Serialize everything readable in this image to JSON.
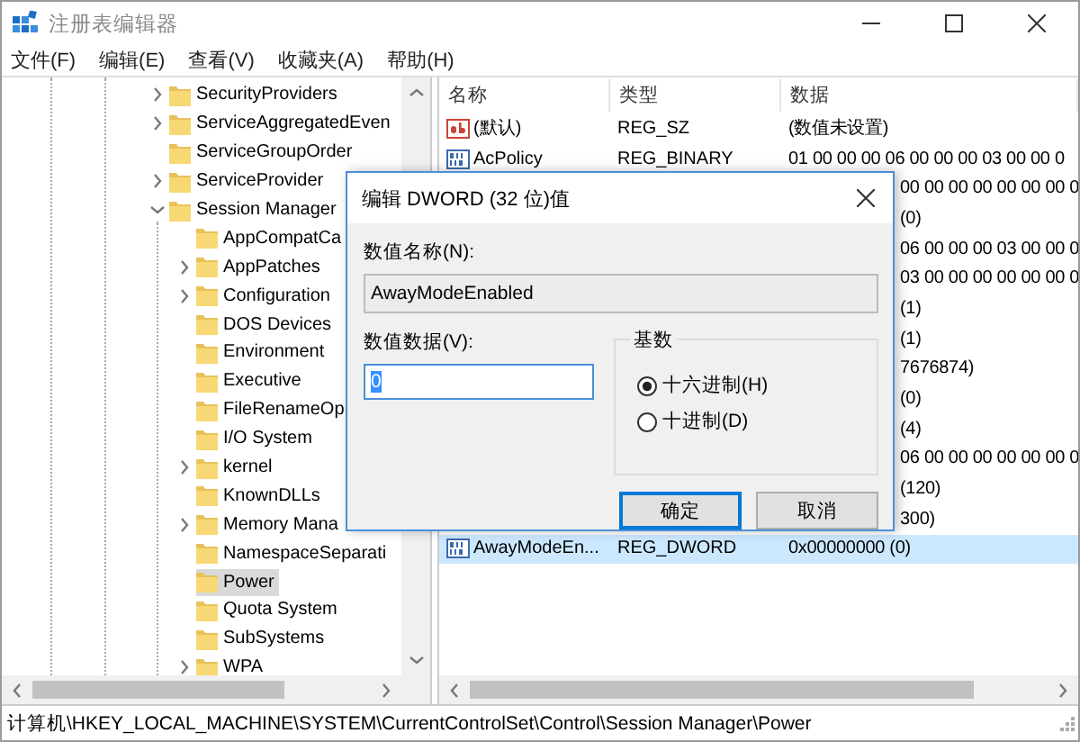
{
  "window": {
    "title": "注册表编辑器"
  },
  "menu": [
    "文件(F)",
    "编辑(E)",
    "查看(V)",
    "收藏夹(A)",
    "帮助(H)"
  ],
  "tree": {
    "items": [
      {
        "label": "SecurityProviders",
        "expandable": true,
        "expanded": false,
        "selected": false
      },
      {
        "label": "ServiceAggregatedEven",
        "expandable": true,
        "expanded": false,
        "selected": false
      },
      {
        "label": "ServiceGroupOrder",
        "expandable": false,
        "selected": false
      },
      {
        "label": "ServiceProvider",
        "expandable": true,
        "expanded": false,
        "selected": false
      },
      {
        "label": "Session Manager",
        "expandable": true,
        "expanded": true,
        "selected": false,
        "children": [
          {
            "label": "AppCompatCa",
            "expandable": false,
            "selected": false
          },
          {
            "label": "AppPatches",
            "expandable": true,
            "expanded": false,
            "selected": false
          },
          {
            "label": "Configuration",
            "expandable": true,
            "expanded": false,
            "selected": false
          },
          {
            "label": "DOS Devices",
            "expandable": false,
            "selected": false
          },
          {
            "label": "Environment",
            "expandable": false,
            "selected": false
          },
          {
            "label": "Executive",
            "expandable": false,
            "selected": false
          },
          {
            "label": "FileRenameOp",
            "expandable": false,
            "selected": false
          },
          {
            "label": "I/O System",
            "expandable": false,
            "selected": false
          },
          {
            "label": "kernel",
            "expandable": true,
            "expanded": false,
            "selected": false
          },
          {
            "label": "KnownDLLs",
            "expandable": false,
            "selected": false
          },
          {
            "label": "Memory Mana",
            "expandable": true,
            "expanded": false,
            "selected": false
          },
          {
            "label": "NamespaceSeparati",
            "expandable": false,
            "selected": false
          },
          {
            "label": "Power",
            "expandable": false,
            "selected": true
          },
          {
            "label": "Quota System",
            "expandable": false,
            "selected": false
          },
          {
            "label": "SubSystems",
            "expandable": false,
            "selected": false
          },
          {
            "label": "WPA",
            "expandable": true,
            "expanded": false,
            "selected": false
          }
        ]
      }
    ]
  },
  "values": {
    "columns": [
      "名称",
      "类型",
      "数据"
    ],
    "rows": [
      {
        "kind": "string",
        "name": "(默认)",
        "type": "REG_SZ",
        "data": "(数值未设置)",
        "selected": false
      },
      {
        "kind": "binary",
        "name": "AcPolicy",
        "type": "REG_BINARY",
        "data": "01 00 00 00 06 00 00 00 03 00 00 0",
        "selected": false
      },
      {
        "kind": "covered",
        "data": "00 00 00 00 00 00 00 0",
        "selected": false
      },
      {
        "kind": "covered",
        "data": "(0)",
        "selected": false
      },
      {
        "kind": "covered",
        "data": "06 00 00 00 03 00 00 0",
        "selected": false
      },
      {
        "kind": "covered",
        "data": "03 00 00 00 00 00 00 0",
        "selected": false
      },
      {
        "kind": "covered",
        "data": "(1)",
        "selected": false
      },
      {
        "kind": "covered",
        "data": "(1)",
        "selected": false
      },
      {
        "kind": "covered",
        "data": "7676874)",
        "selected": false
      },
      {
        "kind": "covered",
        "data": "(0)",
        "selected": false
      },
      {
        "kind": "covered",
        "data": "(4)",
        "selected": false
      },
      {
        "kind": "covered",
        "data": "06 00 00 00 00 00 00 0",
        "selected": false
      },
      {
        "kind": "covered",
        "data": "(120)",
        "selected": false
      },
      {
        "kind": "covered",
        "data": "300)",
        "selected": false
      },
      {
        "kind": "binary",
        "name": "AwayModeEn...",
        "type": "REG_DWORD",
        "data": "0x00000000 (0)",
        "selected": true
      }
    ]
  },
  "dialog": {
    "title": "编辑 DWORD (32 位)值",
    "name_label": "数值名称(N):",
    "name_value": "AwayModeEnabled",
    "data_label": "数值数据(V):",
    "data_value": "0",
    "data_selected": true,
    "base": {
      "label": "基数",
      "options": [
        {
          "label": "十六进制(H)",
          "selected": true
        },
        {
          "label": "十进制(D)",
          "selected": false
        }
      ]
    },
    "buttons": [
      {
        "label": "确定",
        "default": true
      },
      {
        "label": "取消",
        "default": false
      }
    ]
  },
  "status_bar": "计算机\\HKEY_LOCAL_MACHINE\\SYSTEM\\CurrentControlSet\\Control\\Session Manager\\Power"
}
